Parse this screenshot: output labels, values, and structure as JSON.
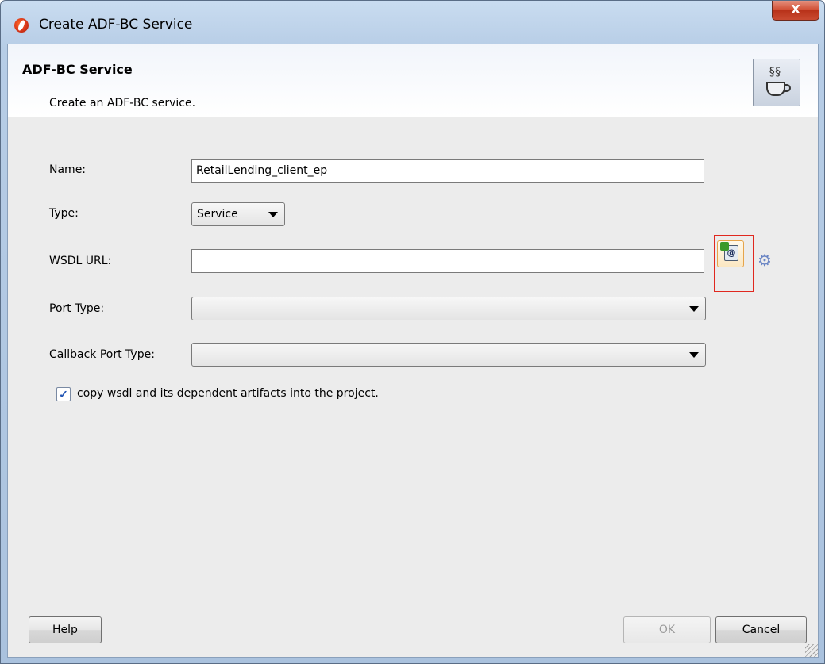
{
  "window": {
    "title": "Create ADF-BC Service",
    "close_label": "X"
  },
  "header": {
    "title": "ADF-BC Service",
    "subtitle": "Create an ADF-BC service.",
    "icon": "java-cup-icon"
  },
  "form": {
    "name_label": "Name:",
    "name_value": "RetailLending_client_ep",
    "type_label": "Type:",
    "type_value": "Service",
    "wsdl_label": "WSDL URL:",
    "wsdl_value": "",
    "port_type_label": "Port Type:",
    "port_type_value": "",
    "callback_label": "Callback Port Type:",
    "callback_value": "",
    "copy_checkbox_label": "copy wsdl and its dependent artifacts into the project.",
    "copy_checked": true
  },
  "buttons": {
    "help": "Help",
    "ok": "OK",
    "cancel": "Cancel"
  },
  "colors": {
    "highlight_box": "#e0281f",
    "checkbox_mark": "#2457b5"
  }
}
